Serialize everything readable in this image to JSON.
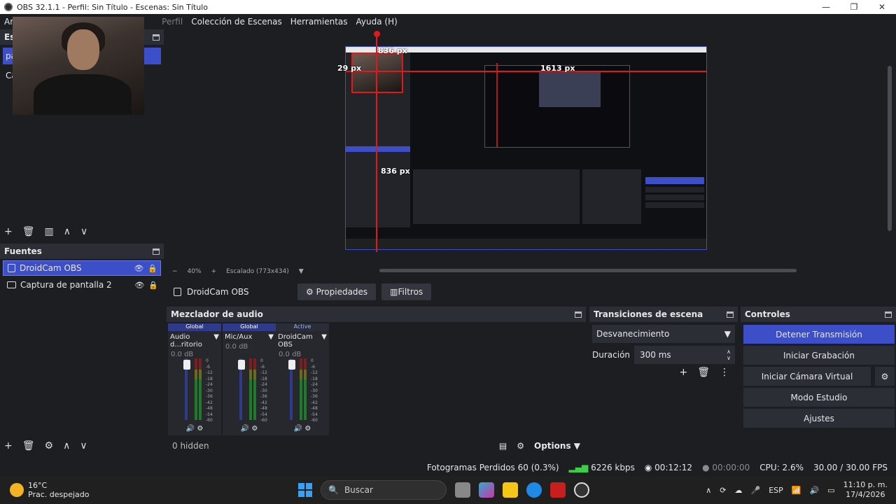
{
  "window": {
    "title": "OBS 32.1.1 - Perfil: Sin Título - Escenas: Sin Título"
  },
  "menu": {
    "items": [
      "Ar",
      "Perfil",
      "Colección de Escenas",
      "Herramientas",
      "Ayuda (H)"
    ]
  },
  "scenes": {
    "header_partial": "Esc",
    "items": [
      "pa",
      "Ca"
    ]
  },
  "sources": {
    "header": "Fuentes",
    "items": [
      {
        "name": "DroidCam OBS",
        "active": true
      },
      {
        "name": "Captura de pantalla 2",
        "active": false
      }
    ]
  },
  "preview": {
    "labels": {
      "top": "836 px",
      "left": "29 px",
      "right": "1613 px",
      "bottom": "836 px"
    },
    "zoom": "40%",
    "scale": "Escalado (773x434)"
  },
  "context": {
    "source": "DroidCam OBS",
    "properties": "Propiedades",
    "filters": "Filtros"
  },
  "mixer": {
    "header": "Mezclador de audio",
    "channels": [
      {
        "tag": "Global",
        "name": "Audio d...ritorio",
        "db": "0.0 dB"
      },
      {
        "tag": "Global",
        "name": "Mic/Aux",
        "db": "0.0 dB"
      },
      {
        "tag": "Active",
        "name": "DroidCam OBS",
        "db": "0.0 dB"
      }
    ],
    "scale": [
      "0",
      "-6",
      "-12",
      "-18",
      "-24",
      "-30",
      "-36",
      "-42",
      "-48",
      "-54",
      "-60"
    ],
    "hidden": "0 hidden",
    "options": "Options"
  },
  "transitions": {
    "header": "Transiciones de escena",
    "type": "Desvanecimiento",
    "duration_label": "Duración",
    "duration": "300 ms"
  },
  "controls": {
    "header": "Controles",
    "stream": "Detener Transmisión",
    "record": "Iniciar Grabación",
    "virtualcam": "Iniciar Cámara Virtual",
    "studio": "Modo Estudio",
    "settings": "Ajustes"
  },
  "status": {
    "dropped": "Fotogramas Perdidos 60 (0.3%)",
    "bitrate": "6226 kbps",
    "stream_time": "00:12:12",
    "rec_time": "00:00:00",
    "cpu": "CPU: 2.6%",
    "fps": "30.00 / 30.00 FPS"
  },
  "taskbar": {
    "temp": "16°C",
    "weather": "Prac. despejado",
    "search": "Buscar",
    "lang": "ESP",
    "time": "11:10 p. m.",
    "date": "17/4/2026"
  },
  "colors": {
    "accent": "#3d4ec9",
    "guide": "#e0191c",
    "panel": "#2b2e35"
  }
}
